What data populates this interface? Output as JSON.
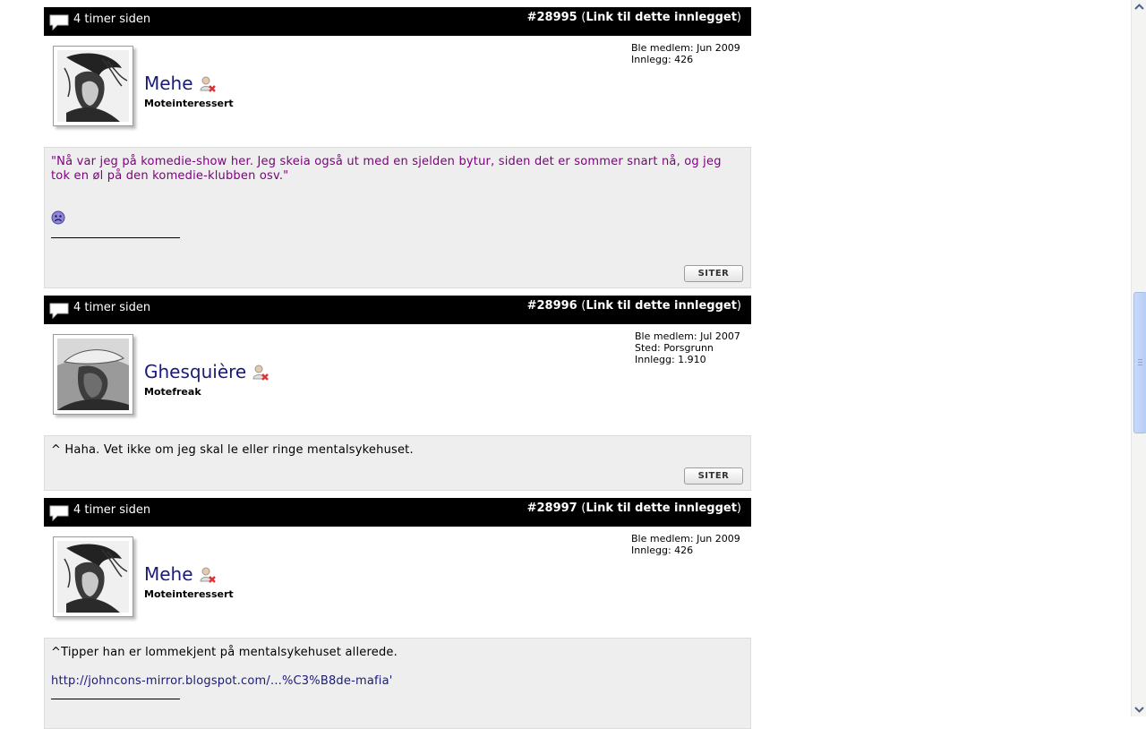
{
  "posts": [
    {
      "time": "4 timer siden",
      "number": "#28995",
      "link_label": "Link til dette innlegget",
      "username": "Mehe",
      "rank": "Moteinteressert",
      "meta": [
        "Ble medlem: Jun 2009",
        "Innlegg: 426"
      ],
      "quote_text": "\"Nå var jeg på komedie-show her. Jeg skeia også ut med en sjelden bytur, siden det er sommer snart nå, og jeg tok en øl på den komedie-klubben osv.\"",
      "quote_button": "SITER"
    },
    {
      "time": "4 timer siden",
      "number": "#28996",
      "link_label": "Link til dette innlegget",
      "username": "Ghesquière",
      "rank": "Motefreak",
      "meta": [
        "Ble medlem: Jul 2007",
        "Sted: Porsgrunn",
        "Innlegg: 1.910"
      ],
      "body_text": "^ Haha. Vet ikke om jeg skal le eller ringe mentalsykehuset.",
      "quote_button": "SITER"
    },
    {
      "time": "4 timer siden",
      "number": "#28997",
      "link_label": "Link til dette innlegget",
      "username": "Mehe",
      "rank": "Moteinteressert",
      "meta": [
        "Ble medlem: Jun 2009",
        "Innlegg: 426"
      ],
      "body_text": "^Tipper han er lommekjent på mentalsykehuset allerede.",
      "body_link": "http://johncons-mirror.blogspot.com/...%C3%B8de-mafia'"
    }
  ],
  "icons": {
    "comment": "speech-bubble-icon",
    "user_status": "user-offline-icon",
    "smiley": "sad-smiley-icon"
  },
  "colors": {
    "header_bg": "#000000",
    "username": "#1a1a7a",
    "quote": "#800080",
    "post_bg": "#eeeeee"
  }
}
